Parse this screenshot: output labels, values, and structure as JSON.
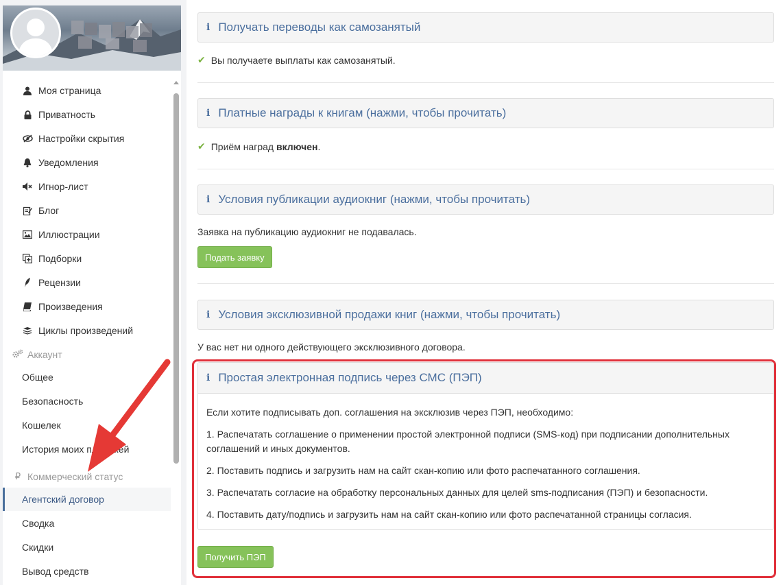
{
  "sidebar": {
    "menu": [
      {
        "label": "Моя страница",
        "icon": "user-icon"
      },
      {
        "label": "Приватность",
        "icon": "lock-icon"
      },
      {
        "label": "Настройки скрытия",
        "icon": "eye-slash-icon"
      },
      {
        "label": "Уведомления",
        "icon": "bell-icon"
      },
      {
        "label": "Игнор-лист",
        "icon": "volume-off-icon"
      },
      {
        "label": "Блог",
        "icon": "edit-icon"
      },
      {
        "label": "Иллюстрации",
        "icon": "picture-icon"
      },
      {
        "label": "Подборки",
        "icon": "collection-icon"
      },
      {
        "label": "Рецензии",
        "icon": "feather-icon"
      },
      {
        "label": "Произведения",
        "icon": "book-icon"
      },
      {
        "label": "Циклы произведений",
        "icon": "stack-icon"
      }
    ],
    "account": {
      "title": "Аккаунт",
      "icon": "gears-icon",
      "items": [
        "Общее",
        "Безопасность",
        "Кошелек",
        "История моих платежей"
      ]
    },
    "commercial": {
      "title": "Коммерческий статус",
      "icon": "ruble-icon",
      "items": [
        "Агентский договор",
        "Сводка",
        "Скидки",
        "Вывод средств"
      ],
      "active_item": "Агентский договор"
    }
  },
  "main": {
    "self_employed": {
      "title": "Получать переводы как самозанятый",
      "status": "Вы получаете выплаты как самозанятый."
    },
    "paid_rewards": {
      "title": "Платные награды к книгам (нажми, чтобы прочитать)",
      "status_prefix": "Приём наград ",
      "status_bold": "включен",
      "status_suffix": "."
    },
    "audiobooks": {
      "title": "Условия публикации аудиокниг (нажми, чтобы прочитать)",
      "status": "Заявка на публикацию аудиокниг не подавалась.",
      "button": "Подать заявку"
    },
    "exclusive": {
      "title": "Условия эксклюзивной продажи книг (нажми, чтобы прочитать)",
      "status": "У вас нет ни одного действующего эксклюзивного договора."
    },
    "pep": {
      "title": "Простая электронная подпись через СМС (ПЭП)",
      "intro": "Если хотите подписывать доп. соглашения на эксклюзив через ПЭП, необходимо:",
      "steps": [
        "1. Распечатать соглашение о применении простой электронной подписи (SMS-код) при подписании дополнительных соглашений и иных документов.",
        "2. Поставить подпись и загрузить нам на сайт скан-копию или фото распечатанного соглашения.",
        "3. Распечатать согласие на обработку персональных данных для целей sms-подписания (ПЭП) и безопасности.",
        "4. Поставить дату/подпись и загрузить нам на сайт скан-копию или фото распечатанной страницы согласия."
      ],
      "button": "Получить ПЭП"
    }
  },
  "colors": {
    "accent_blue": "#4b6f9e",
    "success_green": "#7cb342",
    "button_green": "#86c25a",
    "highlight_red": "#e0303a"
  },
  "icons": {
    "info": "info-icon",
    "check": "check-icon",
    "annotation": "red-arrow"
  }
}
